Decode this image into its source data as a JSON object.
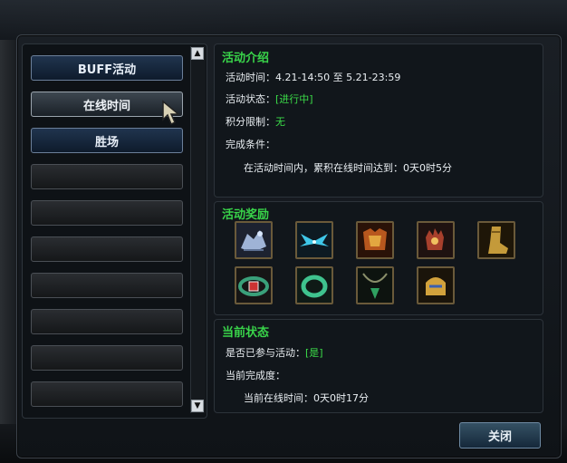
{
  "nav": {
    "items": [
      {
        "label": "BUFF活动",
        "state": "blue"
      },
      {
        "label": "在线时间",
        "state": "selected"
      },
      {
        "label": "胜场",
        "state": "blue"
      },
      {
        "label": "",
        "state": "empty"
      },
      {
        "label": "",
        "state": "empty"
      },
      {
        "label": "",
        "state": "empty"
      },
      {
        "label": "",
        "state": "empty"
      },
      {
        "label": "",
        "state": "empty"
      },
      {
        "label": "",
        "state": "empty"
      },
      {
        "label": "",
        "state": "empty"
      }
    ]
  },
  "intro": {
    "title": "活动介绍",
    "time_label": "活动时间：",
    "time_value": "4.21-14:50 至 5.21-23:59",
    "status_label": "活动状态：",
    "status_value": "[进行中]",
    "score_label": "积分限制：",
    "score_value": "无",
    "condition_label": "完成条件：",
    "condition_value": "在活动时间内，累积在线时间达到：0天0时5分"
  },
  "rewards": {
    "title": "活动奖励",
    "items": [
      {
        "icon": "beast-mount-icon"
      },
      {
        "icon": "blue-wings-icon"
      },
      {
        "icon": "gold-armor-icon"
      },
      {
        "icon": "red-gauntlet-icon"
      },
      {
        "icon": "gold-boots-icon"
      },
      {
        "icon": "green-belt-icon"
      },
      {
        "icon": "jade-ring-icon"
      },
      {
        "icon": "green-necklace-icon"
      },
      {
        "icon": "gold-helmet-icon"
      }
    ]
  },
  "current": {
    "title": "当前状态",
    "joined_label": "是否已参与活动：",
    "joined_value": "[是]",
    "progress_label": "当前完成度：",
    "online_label": "当前在线时间：",
    "online_value": "0天0时17分"
  },
  "close_label": "关闭",
  "colors": {
    "accent_green": "#39d44a",
    "text": "#e9eef2",
    "button_blue": "#20344e"
  }
}
